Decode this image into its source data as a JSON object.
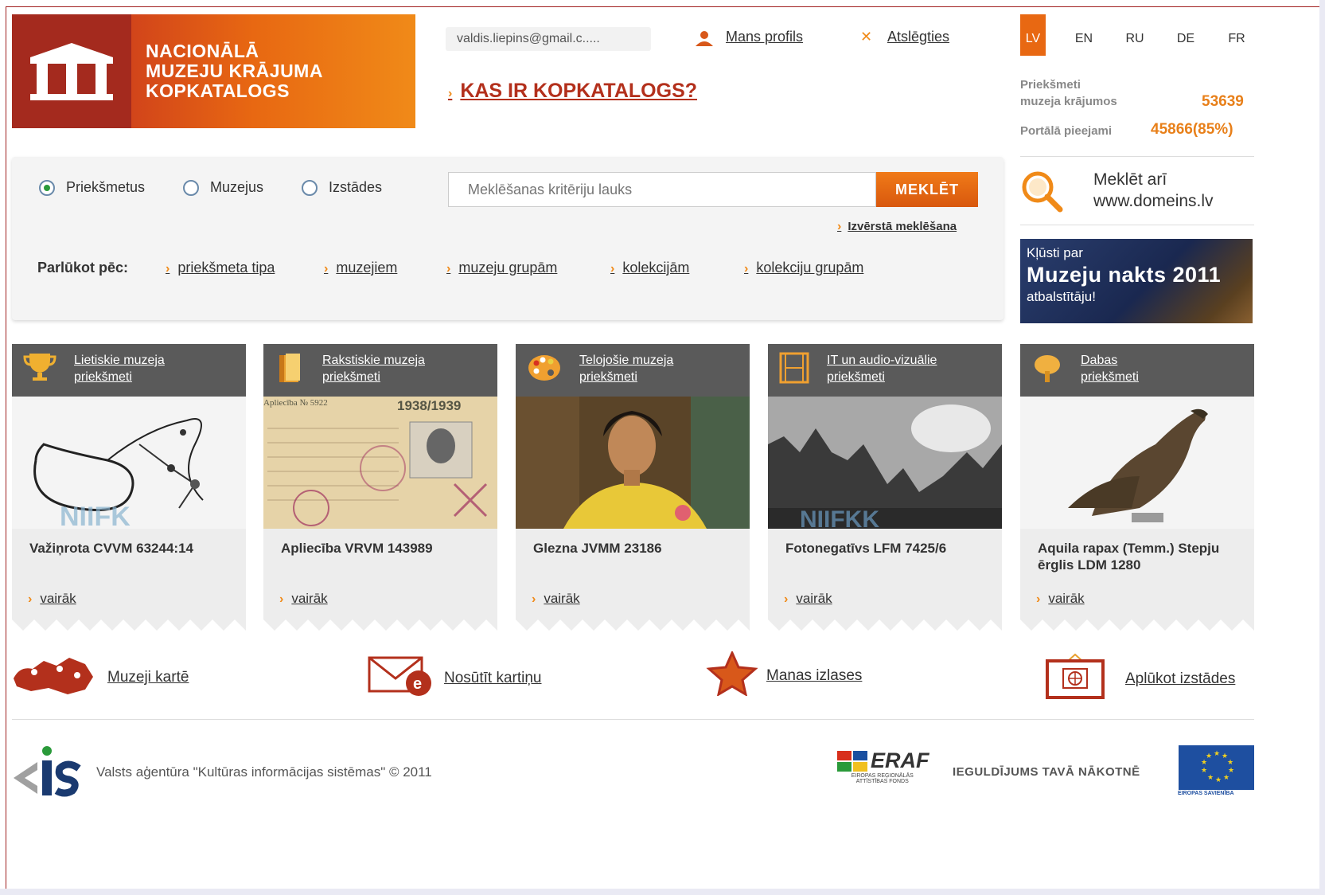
{
  "logo": {
    "line1": "NACIONĀLĀ",
    "line2": "MUZEJU KRĀJUMA",
    "line3": "KOPKATALOGS"
  },
  "header": {
    "email": "valdis.liepins@gmail.c.....",
    "profile": "Mans profils",
    "logout": "Atslēgties",
    "whatis": "KAS IR KOPKATALOGS?"
  },
  "languages": [
    "LV",
    "EN",
    "RU",
    "DE",
    "FR"
  ],
  "stats": {
    "items_label_1": "Priekšmeti",
    "items_label_2": "muzeja krājumos",
    "items_value": "53639",
    "portal_label": "Portālā pieejami",
    "portal_value": "45866(85%)"
  },
  "search": {
    "radios": [
      "Priekšmetus",
      "Muzejus",
      "Izstādes"
    ],
    "selected": "Priekšmetus",
    "placeholder": "Meklēšanas kritēriju lauks",
    "button": "MEKLĒT",
    "advanced": "Izvērstā meklēšana"
  },
  "browse": {
    "label": "Parlūkot pēc:",
    "links": [
      "priekšmeta tipa",
      "muzejiem",
      "muzeju grupām",
      "kolekcijām",
      "kolekciju grupām"
    ]
  },
  "sidebar": {
    "also_line1": "Meklēt arī",
    "also_line2": "www.domeins.lv",
    "banner_line1": "Kļūsti par",
    "banner_line2": "Muzeju nakts 2011",
    "banner_line3": "atbalstītāju!"
  },
  "cards": [
    {
      "cat1": "Lietiskie muzeja",
      "cat2": "priekšmeti",
      "title": "Važiņrota CVVM 63244:14",
      "more": "vairāk"
    },
    {
      "cat1": "Rakstiskie muzeja",
      "cat2": "priekšmeti",
      "title": "Apliecība VRVM 143989",
      "more": "vairāk"
    },
    {
      "cat1": "Telojošie muzeja",
      "cat2": "priekšmeti",
      "title": "Glezna JVMM 23186",
      "more": "vairāk"
    },
    {
      "cat1": "IT un audio-vizuālie",
      "cat2": "priekšmeti",
      "title": "Fotonegatīvs LFM 7425/6",
      "more": "vairāk"
    },
    {
      "cat1": "Dabas",
      "cat2": "priekšmeti",
      "title": "Aquila rapax (Temm.) Stepju ērglis LDM 1280",
      "more": "vairāk"
    }
  ],
  "card_image_text": {
    "doc_label": "Apliecība № 5922",
    "doc_year": "1938/1939"
  },
  "features": [
    "Muzeji kartē",
    "Nosūtīt kartiņu",
    "Manas izlases",
    "Aplūkot izstādes"
  ],
  "footer": {
    "text": "Valsts aģentūra \"Kultūras informācijas sistēmas\" © 2011",
    "eraf": "ERAF",
    "eraf_sub1": "EIROPAS REĢIONĀLĀS",
    "eraf_sub2": "ATTĪSTĪBAS FONDS",
    "invest": "IEGULDĪJUMS TAVĀ NĀKOTNĒ",
    "eu_label": "EIROPAS SAVIENĪBA"
  },
  "colors": {
    "accent": "#e86812",
    "brand_dark": "#a42a1e",
    "title_red": "#b3301c"
  }
}
